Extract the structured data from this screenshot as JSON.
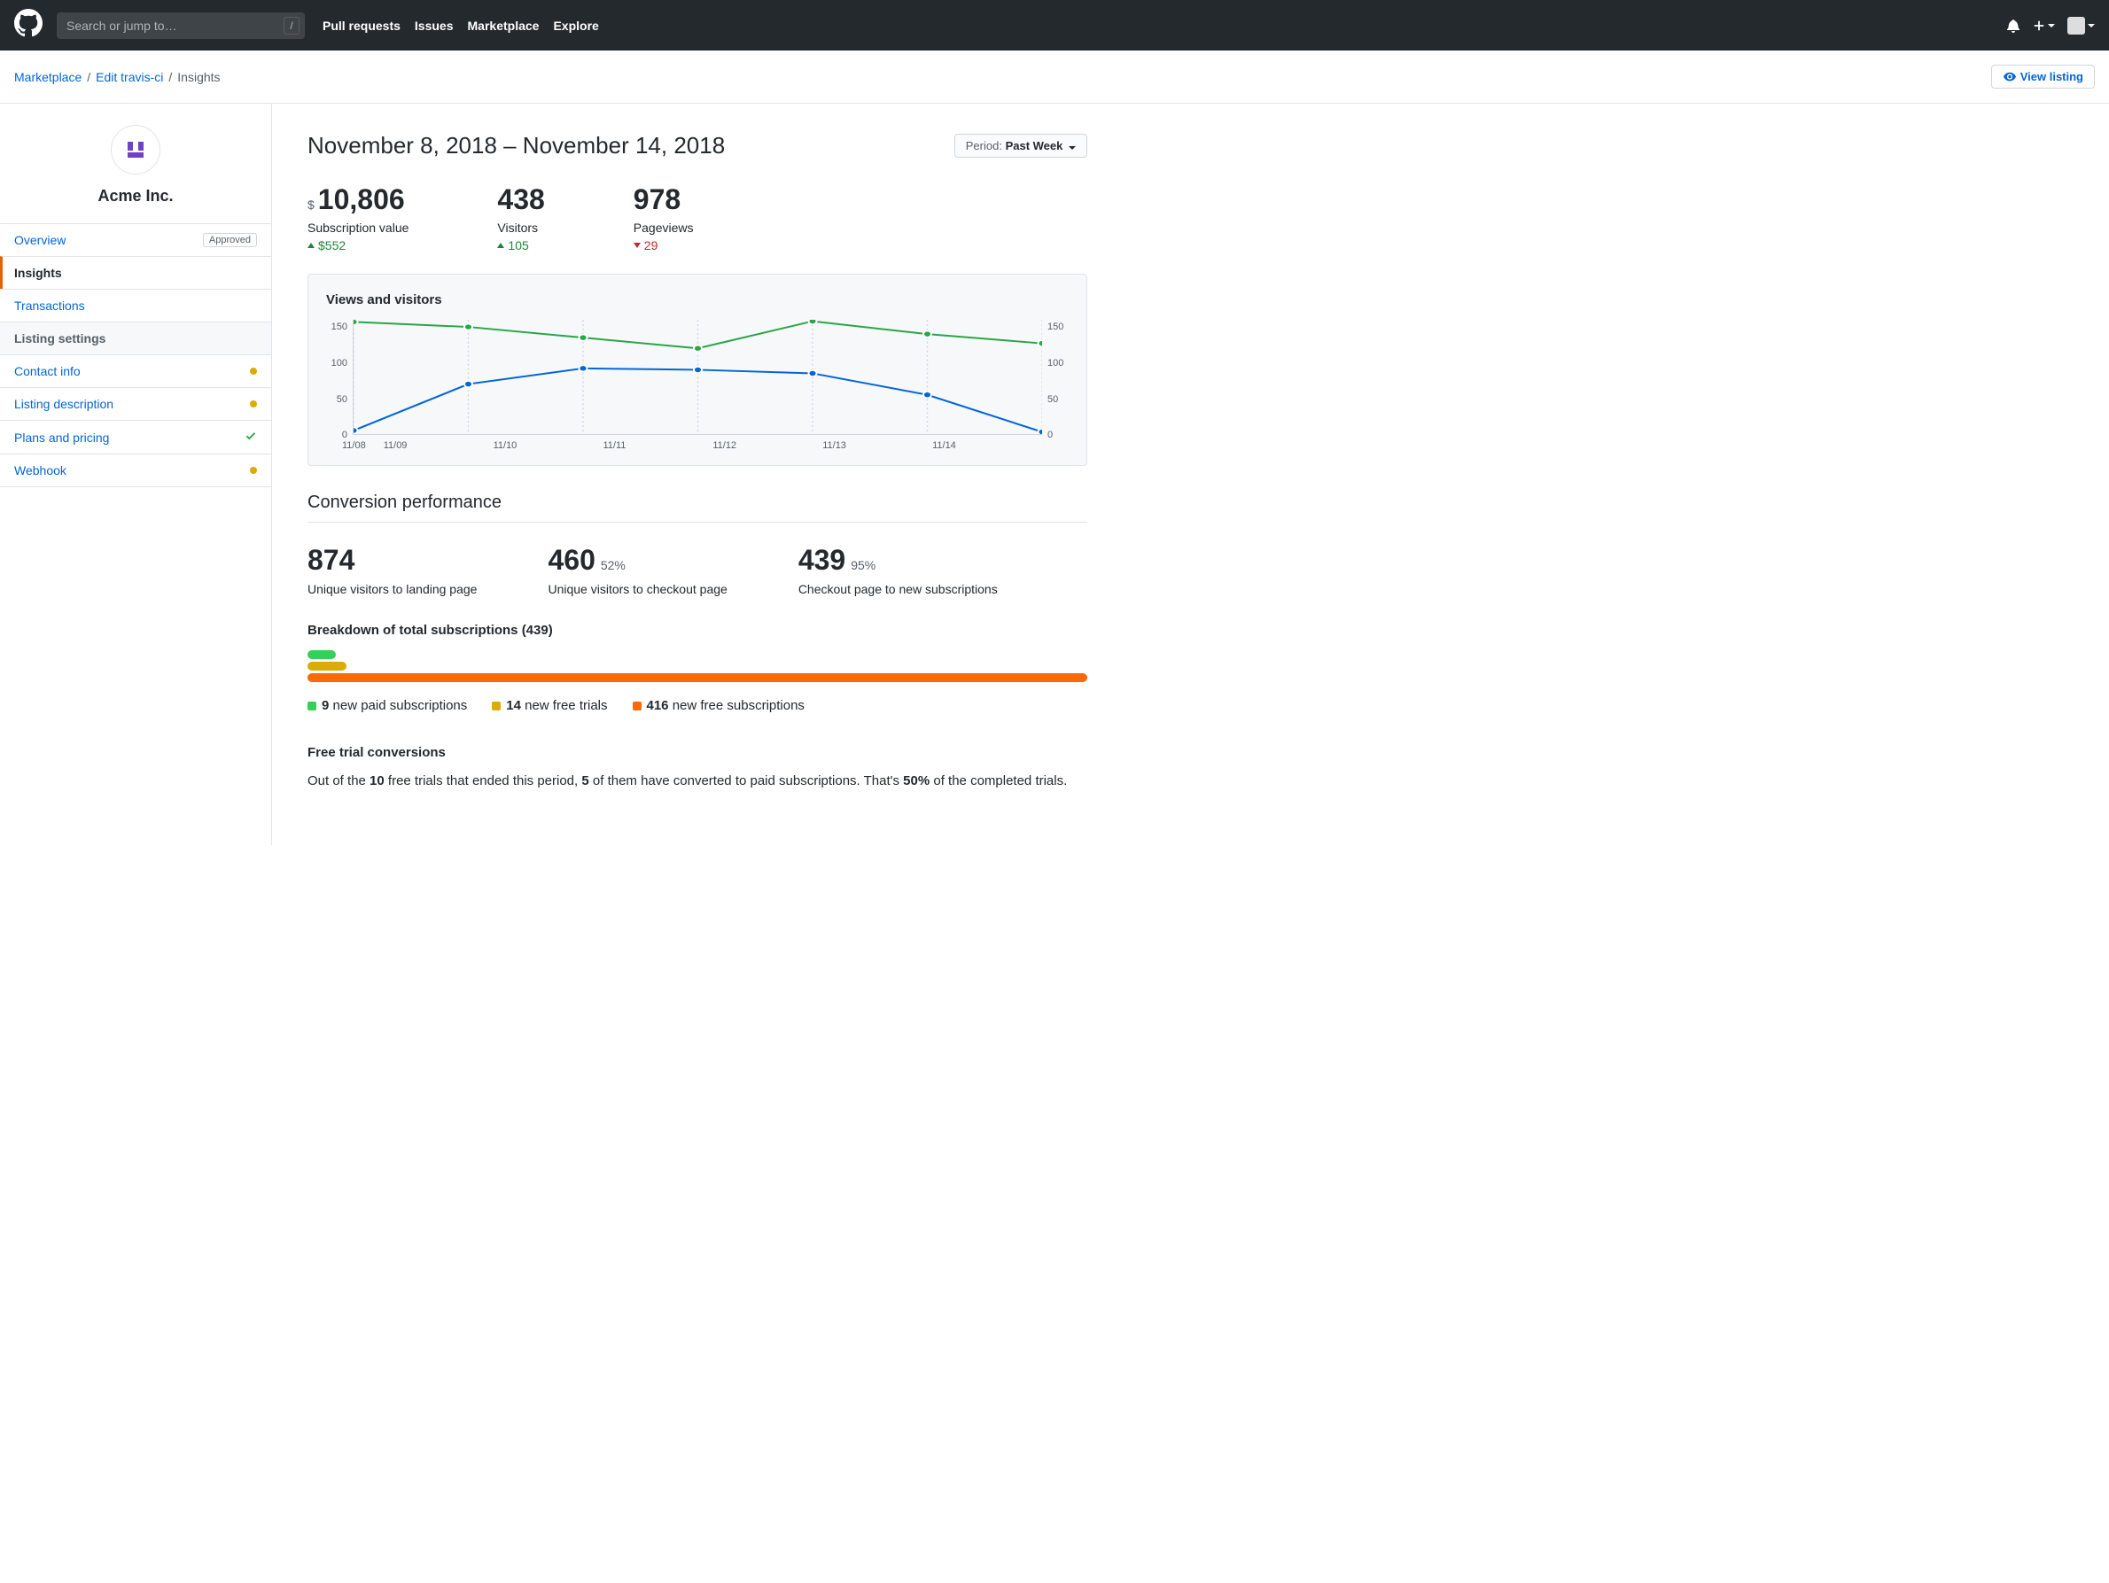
{
  "header": {
    "search_placeholder": "Search or jump to…",
    "nav": [
      "Pull requests",
      "Issues",
      "Marketplace",
      "Explore"
    ]
  },
  "breadcrumb": {
    "a": "Marketplace",
    "b": "Edit travis-ci",
    "c": "Insights",
    "view_listing": "View listing"
  },
  "sidebar": {
    "org": "Acme Inc.",
    "items": [
      {
        "label": "Overview",
        "badge": "Approved"
      },
      {
        "label": "Insights",
        "active": true
      },
      {
        "label": "Transactions"
      }
    ],
    "settings_header": "Listing settings",
    "settings": [
      {
        "label": "Contact info"
      },
      {
        "label": "Listing description"
      },
      {
        "label": "Plans and pricing"
      },
      {
        "label": "Webhook"
      }
    ]
  },
  "page": {
    "title": "November 8, 2018 – November 14, 2018",
    "period_label": "Period: ",
    "period_value": "Past Week"
  },
  "stats": {
    "sub_value": "10,806",
    "sub_label": "Subscription value",
    "sub_delta": "$552",
    "visitors_value": "438",
    "visitors_label": "Visitors",
    "visitors_delta": "105",
    "pv_value": "978",
    "pv_label": "Pageviews",
    "pv_delta": "29"
  },
  "chart_data": {
    "type": "line",
    "title": "Views and visitors",
    "categories": [
      "11/08",
      "11/09",
      "11/10",
      "11/11",
      "11/12",
      "11/13",
      "11/14"
    ],
    "series": [
      {
        "name": "visitors",
        "values": [
          157,
          150,
          135,
          120,
          158,
          140,
          127
        ],
        "color": "#28a745"
      },
      {
        "name": "views",
        "values": [
          5,
          70,
          92,
          90,
          85,
          55,
          3
        ],
        "color": "#0366d6"
      }
    ],
    "ylabel": "",
    "xlabel": "",
    "y_left": [
      150,
      100,
      50,
      0
    ],
    "y_right": [
      150,
      100,
      50,
      0
    ],
    "ylim": [
      0,
      160
    ]
  },
  "conversion": {
    "title": "Conversion performance",
    "landing_v": "874",
    "landing_l": "Unique visitors to landing page",
    "checkout_v": "460",
    "checkout_pct": "52%",
    "checkout_l": "Unique visitors to checkout page",
    "subs_v": "439",
    "subs_pct": "95%",
    "subs_l": "Checkout page to new subscriptions"
  },
  "breakdown": {
    "title": "Breakdown of total subscriptions (439)",
    "paid_n": "9",
    "paid_t": " new paid subscriptions",
    "trial_n": "14",
    "trial_t": " new free trials",
    "free_n": "416",
    "free_t": " new free subscriptions"
  },
  "free_trial": {
    "title": "Free trial conversions",
    "p1a": "Out of the ",
    "p1b": "10",
    "p1c": " free trials that ended this period, ",
    "p1d": "5",
    "p1e": " of them have converted to paid subscriptions. That's ",
    "p1f": "50%",
    "p1g": " of the completed trials."
  }
}
